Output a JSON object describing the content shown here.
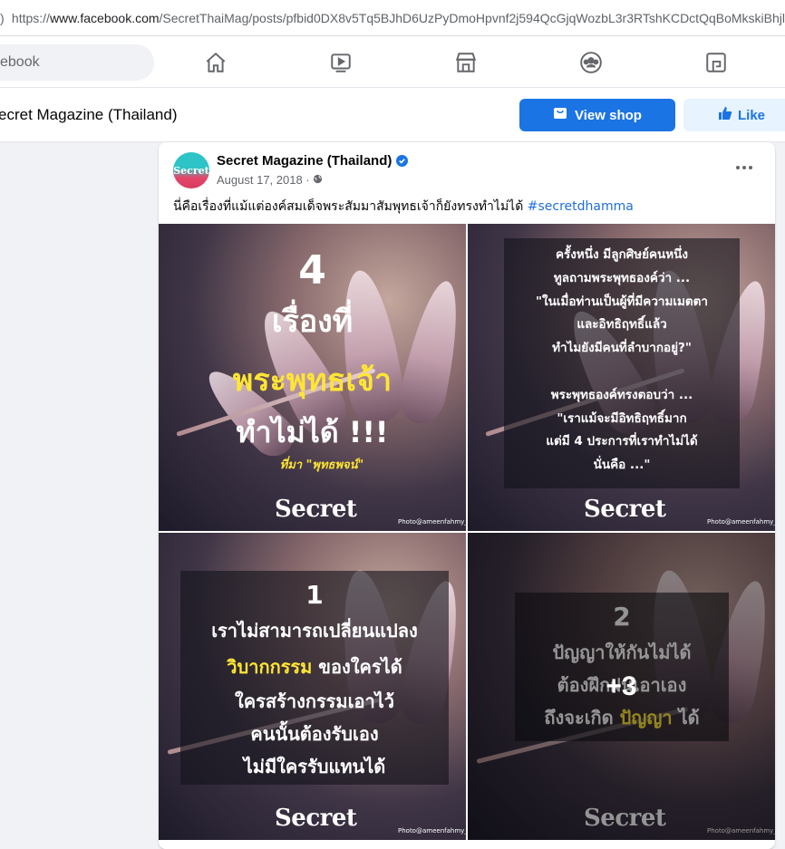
{
  "browser": {
    "lead": ")",
    "url_prefix": "https://",
    "url_host": "www.facebook.com",
    "url_path": "/SecretThaiMag/posts/pfbid0DX8v5Tq5BJhD6UzPyDmoHpvnf2j594QcGjqWozbL3r3RTshKCDctQqBoMkskiBhjl"
  },
  "nav": {
    "search_placeholder": "ebook",
    "icons": [
      "home-icon",
      "watch-icon",
      "marketplace-icon",
      "groups-icon",
      "gaming-icon"
    ]
  },
  "page": {
    "name": "ecret Magazine (Thailand)",
    "view_shop": "View shop",
    "like": "Like"
  },
  "post": {
    "author": "Secret Magazine (Thailand)",
    "avatar_text": "Secret",
    "date": "August 17, 2018 · ",
    "caption": "นี่คือเรื่องที่แม้แต่องค์สมเด็จพระสัมมาสัมพุทธเจ้าก็ยังทรงทำไม่ได้ ",
    "hashtag": "#secretdhamma",
    "brand": "Secret",
    "photo_credit": "Photo@ameenfahmy_",
    "tiles": [
      {
        "lines": [
          "4",
          "เรื่องที่",
          "พระพุทธเจ้า",
          "ทำไม่ได้ !!!"
        ],
        "source": "ที่มา \"พุทธพจน์\""
      },
      {
        "lines": [
          "ครั้งหนึ่ง มีลูกศิษย์คนหนึ่ง",
          "ทูลถามพระพุทธองค์ว่า ...",
          "\"ในเมื่อท่านเป็นผู้ที่มีความเมตตา",
          "และอิทธิฤทธิ์แล้ว",
          "ทำไมยังมีคนที่ลำบากอยู่?\"",
          "",
          "พระพุทธองค์ทรงตอบว่า ...",
          "\"เราแม้จะมีอิทธิฤทธิ์มาก",
          "แต่มี 4 ประการที่เราทำไม่ได้",
          "นั่นคือ ...\""
        ]
      },
      {
        "number": "1",
        "line1": "เราไม่สามารถเปลี่ยนแปลง",
        "line2_highlight": "วิบากกรรม",
        "line2_rest": " ของใครได้",
        "line3": "ใครสร้างกรรมเอาไว้",
        "line4": "คนนั้นต้องรับเอง",
        "line5": "ไม่มีใครรับแทนได้"
      },
      {
        "number": "2",
        "line1": "ปัญญาให้กันไม่ได้",
        "line2": "ต้องฝึกฝนเอาเอง",
        "line3_rest": "ถึงจะเกิด ",
        "line3_highlight": "ปัญญา",
        "line3_end": " ได้",
        "more_count": "+3"
      }
    ]
  },
  "colors": {
    "fb_blue": "#1b74e4",
    "highlight_yellow": "#ffe534",
    "background": "#f0f2f5"
  }
}
